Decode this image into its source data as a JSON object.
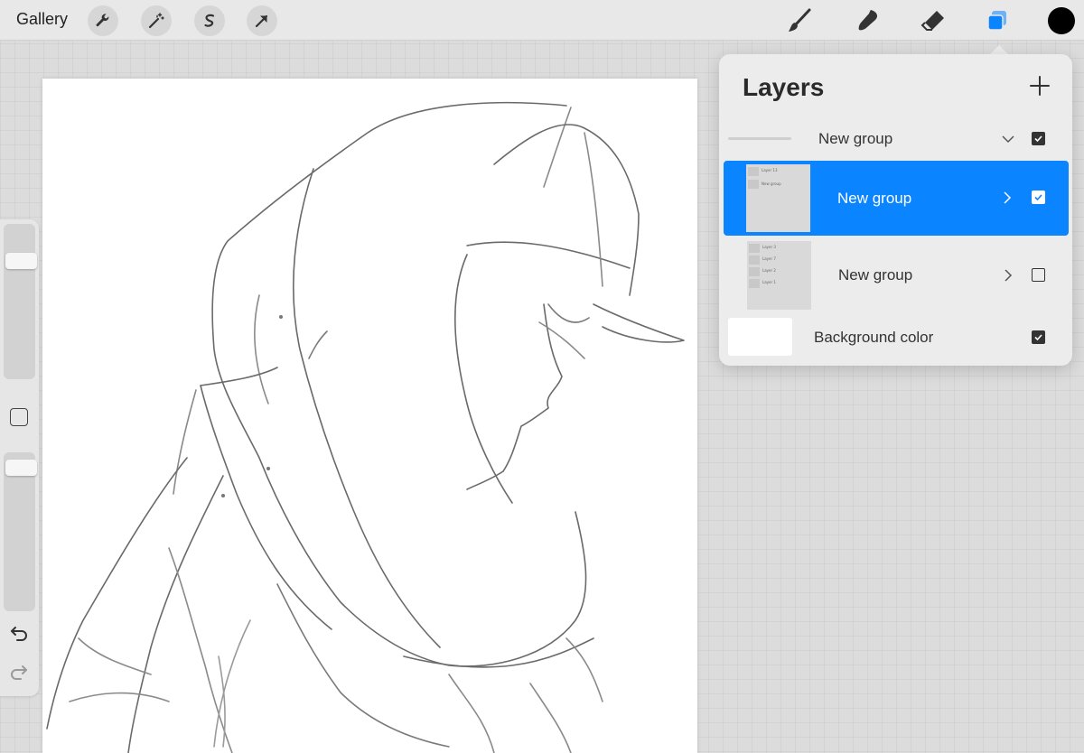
{
  "topbar": {
    "gallery_label": "Gallery",
    "left_tools": [
      "wrench-icon",
      "magic-wand-icon",
      "selection-s-icon",
      "transform-arrow-icon"
    ],
    "right_tools": [
      "brush-icon",
      "smudge-icon",
      "eraser-icon",
      "layers-icon"
    ],
    "active_tool": "layers-icon",
    "accent_color": "#0a84ff",
    "current_color": "#000000"
  },
  "layers_panel": {
    "title": "Layers",
    "rows": [
      {
        "label": "New group",
        "type": "group",
        "expanded": true,
        "visible": true,
        "selected": false
      },
      {
        "label": "New group",
        "type": "group",
        "expanded": false,
        "visible": true,
        "selected": true,
        "thumb_lines": [
          "Layer 13",
          "New group"
        ]
      },
      {
        "label": "New group",
        "type": "group",
        "expanded": false,
        "visible": false,
        "selected": false,
        "thumb_lines": [
          "Layer 3",
          "Layer 7",
          "Layer 2",
          "Layer 1"
        ]
      },
      {
        "label": "Background color",
        "type": "background",
        "visible": true,
        "selected": false,
        "color": "#ffffff"
      }
    ]
  },
  "sidebar": {
    "brush_size_level": 0.2,
    "opacity_level": 0.04,
    "icons": [
      "modify-square-icon",
      "undo-icon",
      "redo-icon"
    ]
  }
}
